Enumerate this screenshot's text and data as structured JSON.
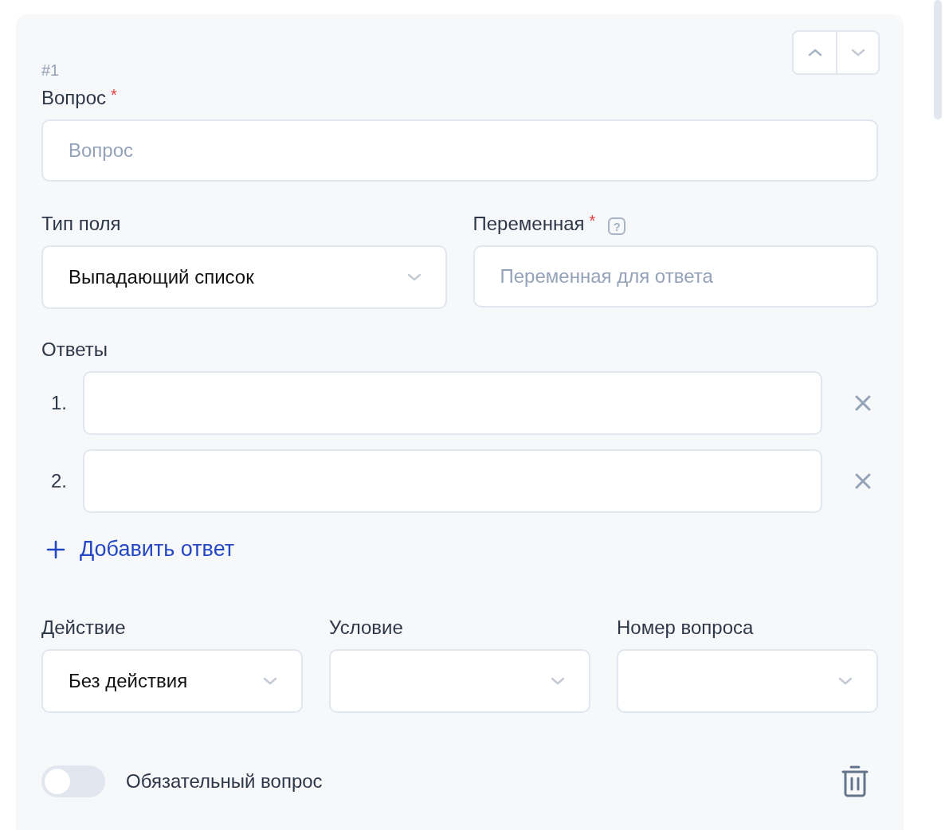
{
  "question_number": "#1",
  "question": {
    "label": "Вопрос",
    "required_mark": "*",
    "placeholder": "Вопрос"
  },
  "field_type": {
    "label": "Тип поля",
    "value": "Выпадающий список"
  },
  "variable": {
    "label": "Переменная",
    "required_mark": "*",
    "help": "?",
    "placeholder": "Переменная для ответа"
  },
  "answers": {
    "label": "Ответы",
    "items": [
      {
        "number": "1."
      },
      {
        "number": "2."
      }
    ]
  },
  "add_answer": "Добавить ответ",
  "rule": [
    {
      "label": "Действие",
      "value": "Без действия"
    },
    {
      "label": "Условие"
    },
    {
      "label": "Номер вопроса"
    }
  ],
  "required_toggle": {
    "label": "Обязательный вопрос",
    "on": false
  }
}
